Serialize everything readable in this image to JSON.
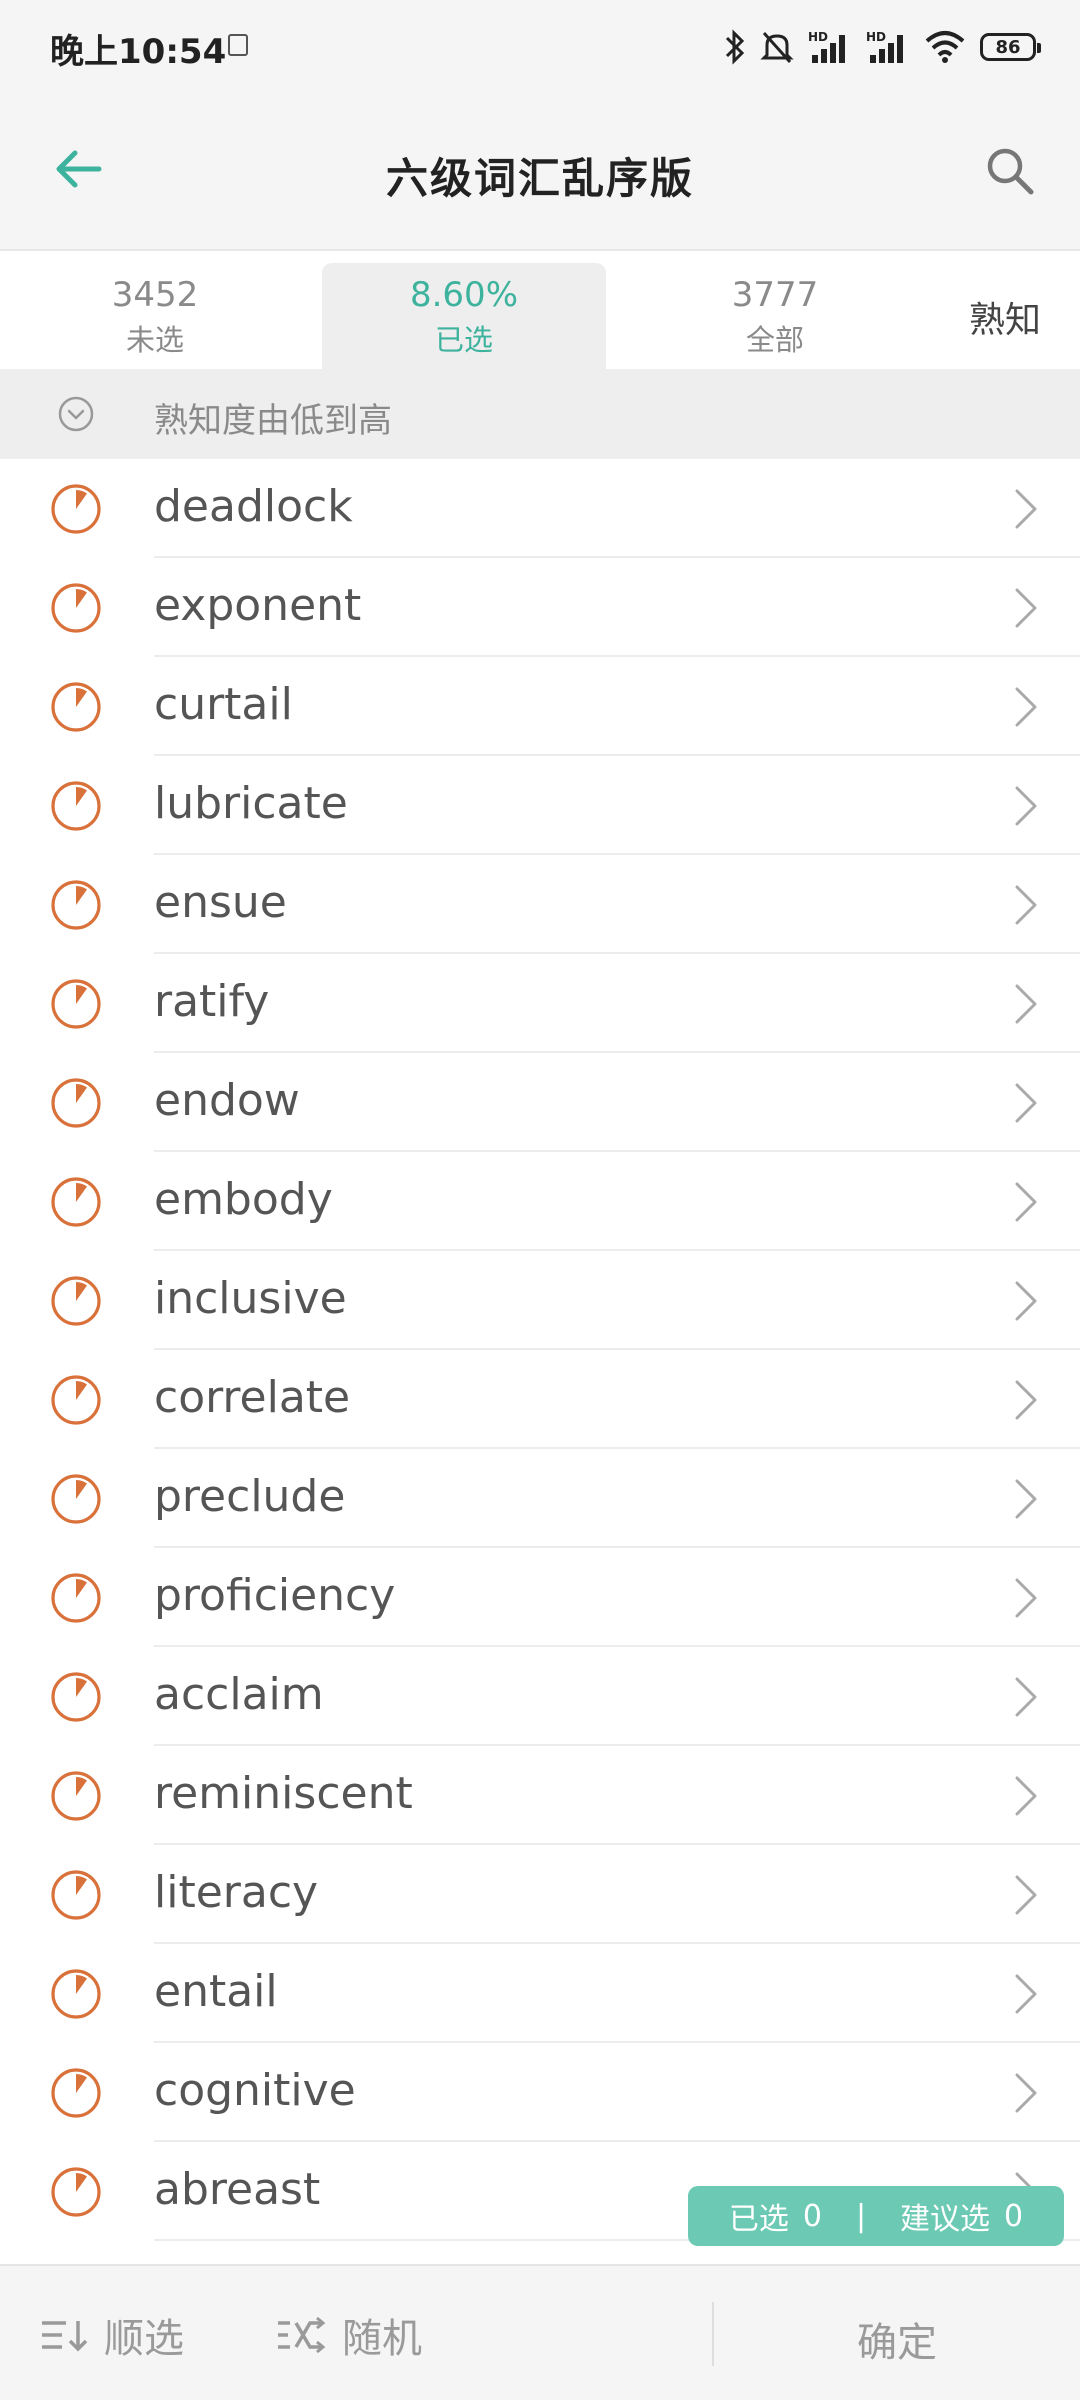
{
  "status_bar": {
    "time": "晚上10:54",
    "battery": "86"
  },
  "header": {
    "title": "六级词汇乱序版"
  },
  "tabs": {
    "unselected": {
      "count": "3452",
      "label": "未选"
    },
    "selected": {
      "count": "8.60%",
      "label": "已选"
    },
    "all": {
      "count": "3777",
      "label": "全部"
    },
    "familiar": {
      "label": "熟知"
    }
  },
  "sort": {
    "label": "熟知度由低到高"
  },
  "words": [
    "deadlock",
    "exponent",
    "curtail",
    "lubricate",
    "ensue",
    "ratify",
    "endow",
    "embody",
    "inclusive",
    "correlate",
    "preclude",
    "proficiency",
    "acclaim",
    "reminiscent",
    "literacy",
    "entail",
    "cognitive",
    "abreast"
  ],
  "selection_badge": {
    "selected_label": "已选",
    "selected_count": "0",
    "separator": "|",
    "suggested_label": "建议选",
    "suggested_count": "0"
  },
  "bottom_bar": {
    "sequential": "顺选",
    "random": "随机",
    "confirm": "确定"
  },
  "colors": {
    "accent": "#3db39e",
    "progress": "#d9713a",
    "badge": "#6cc9b3"
  }
}
